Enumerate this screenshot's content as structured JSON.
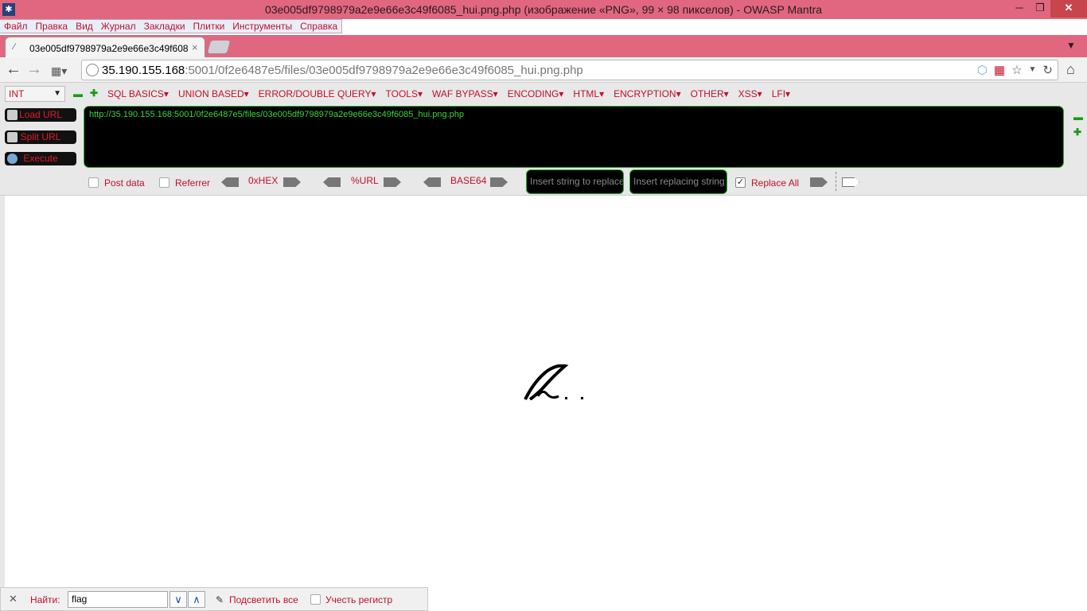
{
  "window": {
    "title": "03e005df9798979a2e9e66e3c49f6085_hui.png.php (изображение «PNG», 99 × 98 пикселов) - OWASP Mantra",
    "min_glyph": "─",
    "max_glyph": "❐",
    "close_glyph": "✕"
  },
  "menubar": [
    "Файл",
    "Правка",
    "Вид",
    "Журнал",
    "Закладки",
    "Плитки",
    "Инструменты",
    "Справка"
  ],
  "tab": {
    "label": "03e005df9798979a2e9e66e3c49f6085_...",
    "close_glyph": "×"
  },
  "navbar": {
    "url_host": "35.190.155.168",
    "url_rest": ":5001/0f2e6487e5/files/03e005df9798979a2e9e66e3c49f6085_hui.png.php"
  },
  "hackbar": {
    "select_value": "INT",
    "menus": [
      "SQL BASICS▾",
      "UNION BASED▾",
      "ERROR/DOUBLE QUERY▾",
      "TOOLS▾",
      "WAF BYPASS▾",
      "ENCODING▾",
      "HTML▾",
      "ENCRYPTION▾",
      "OTHER▾",
      "XSS▾",
      "LFI▾"
    ],
    "load_url": "Load URL",
    "split_url": "Split URL",
    "execute": "Execute",
    "url_value": "http://35.190.155.168:5001/0f2e6487e5/files/03e005df9798979a2e9e66e3c49f6085_hui.png.php",
    "post_data": "Post data",
    "referrer": "Referrer",
    "hex": "0xHEX",
    "url_enc": "%URL",
    "base64": "BASE64",
    "replace_placeholder": "Insert string to replace",
    "replacing_placeholder": "Insert replacing string",
    "replace_all": "Replace All"
  },
  "findbar": {
    "label": "Найти:",
    "value": "flag",
    "highlight_all": "Подсветить все",
    "match_case": "Учесть регистр"
  },
  "colors": {
    "chrome_accent": "#e0677f",
    "hackbar_text": "#c0102a",
    "hackbar_green": "#3ad63a"
  }
}
